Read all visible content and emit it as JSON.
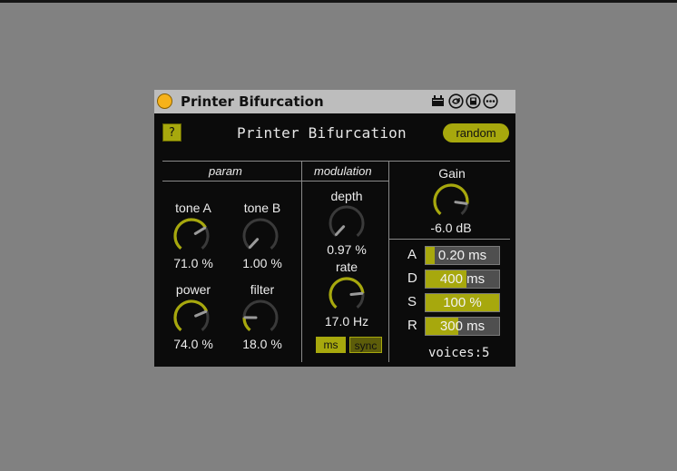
{
  "colors": {
    "accent": "#a7a80d",
    "background": "#0b0b0b",
    "titlebar": "#bdbdbd",
    "knob_track": "#3a3a3a",
    "power": "#f6b21a"
  },
  "titlebar": {
    "title": "Printer Bifurcation",
    "icons": [
      "plug-icon",
      "sync-icon",
      "save-icon",
      "more-icon"
    ]
  },
  "header": {
    "help_label": "?",
    "device_name": "Printer Bifurcation",
    "random_label": "random"
  },
  "sections": {
    "param": "param",
    "modulation": "modulation"
  },
  "param": {
    "tone_a": {
      "label": "tone A",
      "value": "71.0 %",
      "fraction": 0.71
    },
    "tone_b": {
      "label": "tone B",
      "value": "1.00 %",
      "fraction": 0.01
    },
    "power": {
      "label": "power",
      "value": "74.0 %",
      "fraction": 0.74
    },
    "filter": {
      "label": "filter",
      "value": "18.0 %",
      "fraction": 0.18
    }
  },
  "modulation": {
    "depth": {
      "label": "depth",
      "value": "0.97 %",
      "fraction": 0.0097
    },
    "rate": {
      "label": "rate",
      "value": "17.0 Hz",
      "fraction": 0.8
    },
    "ms_label": "ms",
    "sync_label": "sync"
  },
  "gain": {
    "label": "Gain",
    "value": "-6.0 dB",
    "fraction": 0.85
  },
  "adsr": [
    {
      "label": "A",
      "value": "0.20 ms",
      "fill": 0.12
    },
    {
      "label": "D",
      "value": "400 ms",
      "fill": 0.55
    },
    {
      "label": "S",
      "value": "100 %",
      "fill": 1.0
    },
    {
      "label": "R",
      "value": "300 ms",
      "fill": 0.45
    }
  ],
  "voices": "voices:5"
}
